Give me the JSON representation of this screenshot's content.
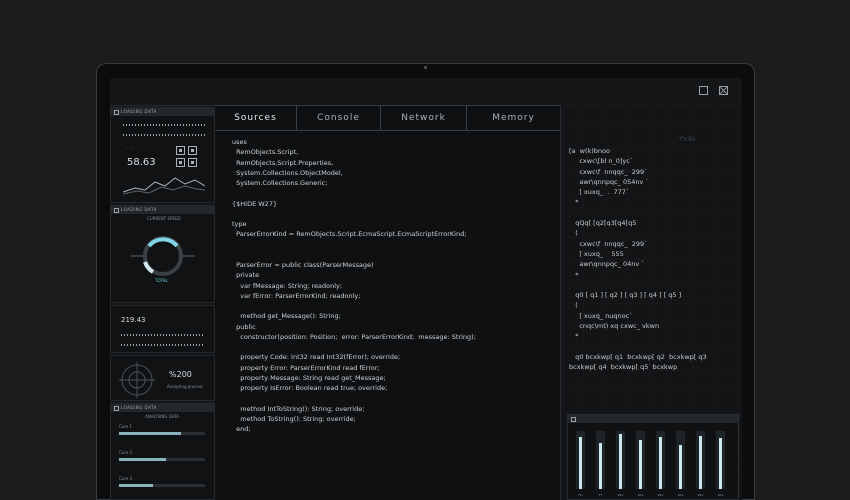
{
  "tabs": [
    {
      "label": "Sources",
      "active": true
    },
    {
      "label": "Console",
      "active": false
    },
    {
      "label": "Network",
      "active": false
    },
    {
      "label": "Memory",
      "active": false
    }
  ],
  "widgets": {
    "w1": {
      "title": "LOADING DATA",
      "value": "58.63"
    },
    "w2": {
      "title": "LOADING DATA",
      "label": "CURRENT SPEED"
    },
    "w3": {
      "value": "219.43"
    },
    "w4": {
      "value": "%200",
      "sub": "Analyzing process"
    },
    "w5": {
      "title": "LOADING DATA",
      "sub": "ANALYSING DATA",
      "items": [
        "Core 1",
        "Core 2",
        "Core 3"
      ],
      "progress": [
        0.72,
        0.55,
        0.4
      ]
    }
  },
  "code_lines": [
    "uses",
    "  RemObjects.Script,",
    "  RemObjects.Script.Properties,",
    "  System.Collections.ObjectModel,",
    "  System.Collections.Generic;",
    "",
    "{$HIDE W27}",
    "",
    "type",
    "  ParserErrorKind = RemObjects.Script.EcmaScript.EcmaScriptErrorKind;",
    "",
    "",
    "  ParserError = public class(ParserMessage)",
    "  private",
    "    var fMessage: String; readonly;",
    "    var fError: ParserErrorKind; readonly;",
    "",
    "    method get_Message(): String;",
    "  public",
    "    constructor(position: Position;  error: ParserErrorKind;  message: String);",
    "",
    "    property Code: Int32 read Int32(fError); override;",
    "    property Error: ParserErrorKind read fError;",
    "    property Message: String read get_Message;",
    "    property IsError: Boolean read true; override;",
    "",
    "    method IntToString(): String; override;",
    "    method ToString(): String; override;",
    "  end;"
  ],
  "right_code": [
    "[a  w(k)bnoo",
    "     cxwc\\[bl n_0]yc`",
    "     cxwc\\f  nnqqc_  299`",
    "     awr\\qnnpqc_ 054nv `",
    "     [ xuxq_  .  777`",
    "   *",
    "",
    "   qQq[ [q2[q3[q4[q5",
    "   (",
    "     cxwc\\f  nnqqc_  299`",
    "     [ xuxq_    555",
    "     awr\\qnnpqc_ 04nv `",
    "   *",
    "",
    "   q0 [ q1 ] [ q2 ] [ q3 ] [ q4 ] [ q5 ]",
    "   (",
    "     [ xuxq_ nuqnoc`",
    "     cnqc\\mt) xq cxwc_ vkwn",
    "   *",
    "",
    "   q0 bcxkwp[ q1  bcxkwp[ q2  bcxkwp[ q3",
    "bcxkwp[ q4  bcxkwp[ q5  bcxkwp"
  ],
  "right_faint": "Yx4k",
  "eq_values": [
    0.9,
    0.8,
    0.95,
    0.85,
    0.9,
    0.75,
    0.92,
    0.88
  ],
  "eq_labels": [
    "FQ",
    "TT",
    "000",
    "000",
    "000",
    "000",
    "000",
    "000"
  ]
}
